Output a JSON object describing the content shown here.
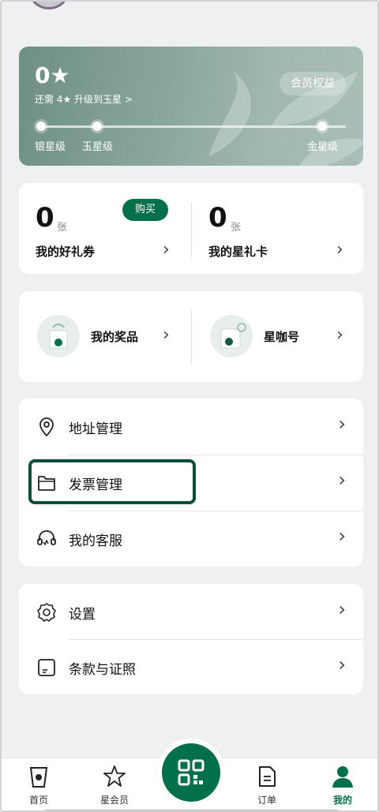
{
  "membership": {
    "stars": "0★",
    "upgrade_tip": "还需 4★ 升级到玉星 >",
    "benefit_button": "会员权益",
    "levels": [
      "银星级",
      "玉星级",
      "金星级"
    ]
  },
  "coupons": {
    "count": "0",
    "unit": "张",
    "label": "我的好礼券",
    "buy_button": "购买"
  },
  "gift_card": {
    "count": "0",
    "unit": "张",
    "label": "我的星礼卡"
  },
  "prizes": {
    "label": "我的奖品"
  },
  "coffee": {
    "label": "星咖号"
  },
  "menu_group_1": [
    {
      "label": "地址管理",
      "icon": "location-pin-icon"
    },
    {
      "label": "发票管理",
      "icon": "folder-icon"
    },
    {
      "label": "我的客服",
      "icon": "headset-icon"
    }
  ],
  "menu_group_2": [
    {
      "label": "设置",
      "icon": "gear-icon"
    },
    {
      "label": "条款与证照",
      "icon": "document-icon"
    }
  ],
  "tabs": [
    {
      "label": "首页",
      "icon": "cup-icon"
    },
    {
      "label": "星会员",
      "icon": "star-icon"
    },
    {
      "label": "",
      "icon": "qr-code-icon"
    },
    {
      "label": "订单",
      "icon": "receipt-icon"
    },
    {
      "label": "我的",
      "icon": "person-icon",
      "active": true
    }
  ],
  "colors": {
    "brand_green": "#00704a",
    "highlight_border": "#0d4d3b"
  }
}
